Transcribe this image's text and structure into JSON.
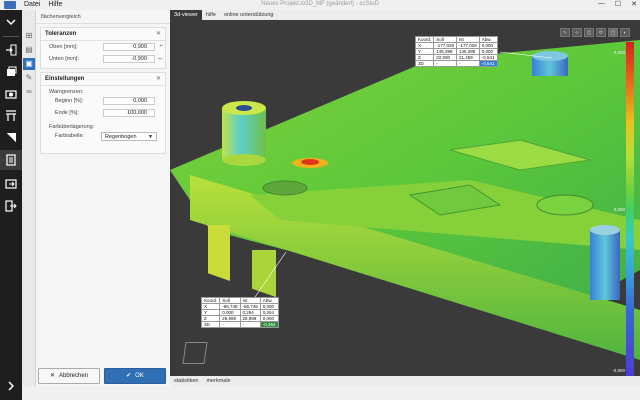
{
  "window": {
    "title": "Neues Projekt.io3D_MF (geändert) - ccStoD",
    "menu": [
      "Datei",
      "Hilfe"
    ],
    "controls": [
      "—",
      "☐",
      "✕"
    ]
  },
  "toolbar": {
    "icons": [
      "chevron-down-icon",
      "import-icon",
      "layers-icon",
      "camera-icon",
      "align-icon",
      "compare-icon",
      "report-icon",
      "export-icon",
      "exit-icon",
      "chevron-right-icon"
    ]
  },
  "panel": {
    "header": "flächenvergleich",
    "tolerances": {
      "title": "Toleranzen",
      "upper_label": "Oben [mm]:",
      "upper_value": "0,900",
      "lower_label": "Unten [mm]:",
      "lower_value": "-0,900"
    },
    "settings": {
      "title": "Einstellungen",
      "warn_label": "Warngrenzen:",
      "begin_label": "Beginn [%]:",
      "begin_value": "0,000",
      "end_label": "Ende [%]:",
      "end_value": "100,000",
      "color_label": "Farbüberlagerung:",
      "table_label": "Farbtabelle:",
      "table_value": "Regenbogen"
    },
    "cancel_label": "Abbrechen",
    "ok_label": "OK"
  },
  "viewer": {
    "tabs": [
      "3d-viewer",
      "hilfe",
      "online unterstützung"
    ],
    "bottom_tabs": [
      "statistiken",
      "merkmale"
    ],
    "cube_label": "",
    "legend": {
      "max": "0,900",
      "mid": "0,000",
      "min": "-0,900"
    },
    "table_top": {
      "headers": [
        "Koord.",
        "Soll",
        "Ist",
        "Abw."
      ],
      "rows": [
        [
          "X",
          "-177,028",
          "-177,028",
          "0,000"
        ],
        [
          "Y",
          "145,398",
          "145,398",
          "0,000"
        ],
        [
          "Z",
          "22,000",
          "21,459",
          "-0,541"
        ],
        [
          "3D",
          "-",
          "-",
          "-0,541"
        ]
      ]
    },
    "table_bottom": {
      "headers": [
        "Koord.",
        "Soll",
        "Ist",
        "Abw."
      ],
      "rows": [
        [
          "X",
          "-66,748",
          "-66,748",
          "0,000"
        ],
        [
          "Y",
          "0,000",
          "0,264",
          "0,264"
        ],
        [
          "Z",
          "26,999",
          "26,999",
          "0,000"
        ],
        [
          "3D",
          "-",
          "-",
          "-0,264"
        ]
      ]
    }
  },
  "colors": {
    "toolbar_bg": "#1e1e1e",
    "accent": "#2f6fb5",
    "viewport_bg": "#3a3a3a",
    "deviation_positive": "#d62020",
    "deviation_zero": "#6fd13f",
    "deviation_negative": "#4f3bd0"
  }
}
